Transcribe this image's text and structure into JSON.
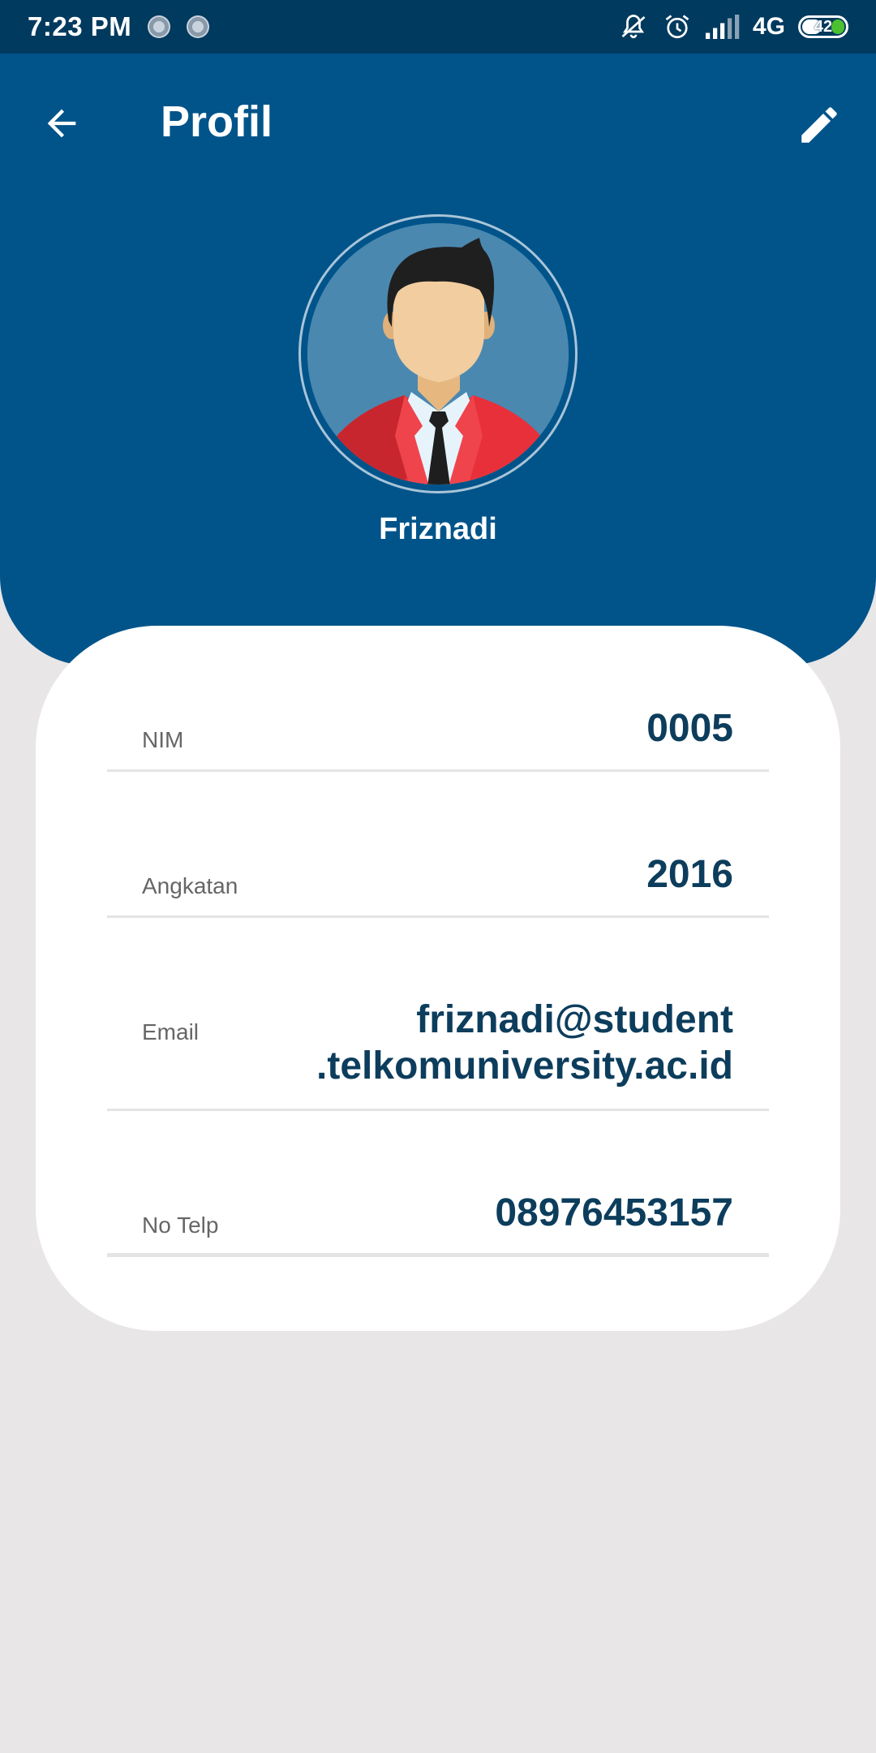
{
  "status_bar": {
    "time": "7:23 PM",
    "network": "4G",
    "battery": "42"
  },
  "header": {
    "title": "Profil",
    "user_name": "Friznadi"
  },
  "profile_fields": [
    {
      "label": "NIM",
      "value": "0005"
    },
    {
      "label": "Angkatan",
      "value": "2016"
    },
    {
      "label": "Email",
      "value_line1": "friznadi@student",
      "value_line2": ".telkomuniversity.ac.id"
    },
    {
      "label": "No Telp",
      "value": "08976453157"
    }
  ],
  "icons": [
    "back-arrow-icon",
    "edit-pencil-icon",
    "mute-icon",
    "alarm-icon",
    "signal-icon",
    "battery-icon"
  ],
  "colors": {
    "status_bar": "#003a5e",
    "header": "#00548a",
    "background": "#e8e6e7",
    "value_text": "#0d3d5c"
  }
}
